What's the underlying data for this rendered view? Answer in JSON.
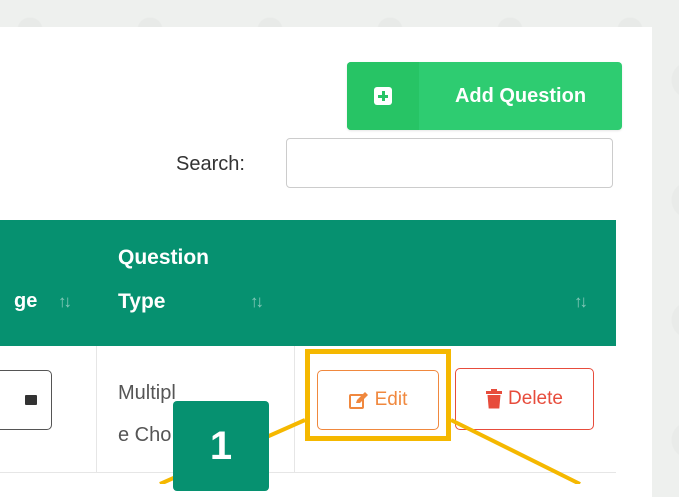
{
  "toolbar": {
    "add_question_label": "Add Question"
  },
  "search": {
    "label": "Search:",
    "value": "",
    "placeholder": ""
  },
  "table": {
    "headers": {
      "col1_fragment": "ge",
      "question_type_line1": "Question",
      "question_type_line2": "Type",
      "sort_glyph": "↑↓"
    },
    "rows": [
      {
        "question_type": "Multiple Cho",
        "edit_label": "Edit",
        "delete_label": "Delete"
      }
    ]
  },
  "annotation": {
    "step_number": "1",
    "highlight_color": "#f5b800"
  },
  "colors": {
    "accent_green": "#2ecc71",
    "header_teal": "#069170",
    "edit_orange": "#f0883e",
    "delete_red": "#e74c3c"
  },
  "icons": {
    "add": "plus-square-icon",
    "edit": "pencil-square-icon",
    "delete": "trash-icon",
    "view": "window-icon"
  }
}
